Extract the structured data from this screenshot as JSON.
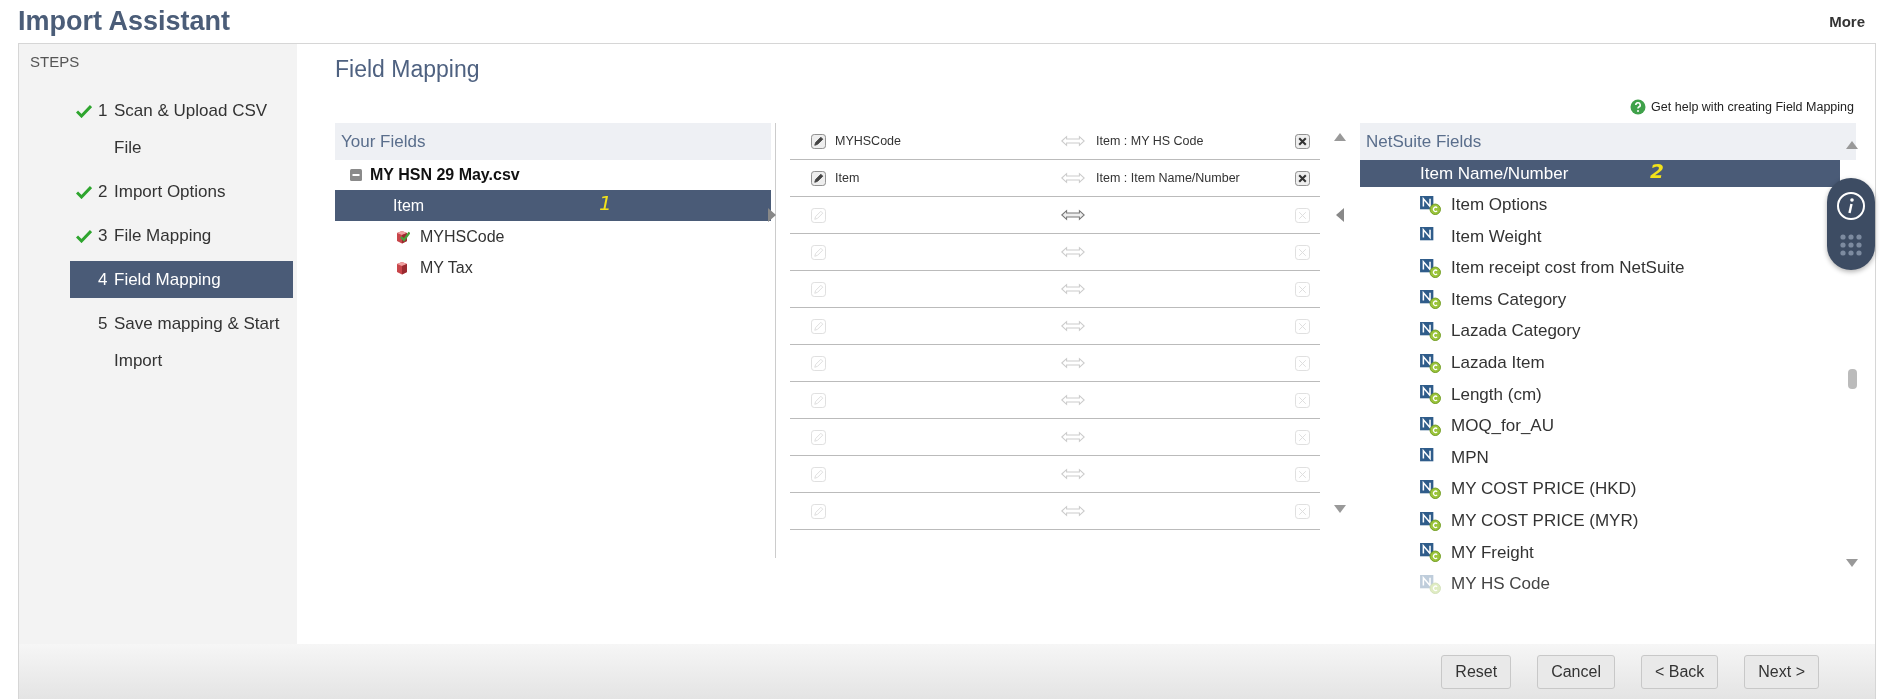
{
  "header": {
    "title": "Import Assistant",
    "more_link": "More"
  },
  "steps": {
    "heading": "STEPS",
    "items": [
      {
        "number": "1",
        "label": "Scan & Upload CSV File",
        "completed": true,
        "selected": false
      },
      {
        "number": "2",
        "label": "Import Options",
        "completed": true,
        "selected": false
      },
      {
        "number": "3",
        "label": "File Mapping",
        "completed": true,
        "selected": false
      },
      {
        "number": "4",
        "label": "Field Mapping",
        "completed": false,
        "selected": true
      },
      {
        "number": "5",
        "label": "Save mapping & Start Import",
        "completed": false,
        "selected": false
      }
    ]
  },
  "page_title": "Field Mapping",
  "help_link": "Get help with creating Field Mapping",
  "your_fields": {
    "heading": "Your Fields",
    "file": {
      "name": "MY HSN 29 May.csv",
      "expanded": true,
      "children": [
        {
          "label": "Item",
          "selected": true,
          "annotation": "1",
          "children": [
            {
              "label": "MYHSCode",
              "kind": "mapped",
              "selected": false
            },
            {
              "label": "MY Tax",
              "kind": "unmapped",
              "selected": false
            }
          ]
        }
      ]
    }
  },
  "mappings": [
    {
      "source": "MYHSCode",
      "target": "Item : MY HS Code",
      "enabled": true,
      "selected": false
    },
    {
      "source": "Item",
      "target": "Item : Item Name/Number",
      "enabled": true,
      "selected": false
    },
    {
      "enabled": false,
      "selected": true
    },
    {
      "enabled": false,
      "selected": false
    },
    {
      "enabled": false,
      "selected": false
    },
    {
      "enabled": false,
      "selected": false
    },
    {
      "enabled": false,
      "selected": false
    },
    {
      "enabled": false,
      "selected": false
    },
    {
      "enabled": false,
      "selected": false
    },
    {
      "enabled": false,
      "selected": false
    },
    {
      "enabled": false,
      "selected": false
    }
  ],
  "netsuite_fields": {
    "heading": "NetSuite Fields",
    "items": [
      {
        "label": "Item Name/Number",
        "kind": "none",
        "selected": true,
        "disabled": false,
        "annotation": "2"
      },
      {
        "label": "Item Options",
        "kind": "custom",
        "selected": false,
        "disabled": false
      },
      {
        "label": "Item Weight",
        "kind": "standard",
        "selected": false,
        "disabled": false
      },
      {
        "label": "Item receipt cost from NetSuite",
        "kind": "custom",
        "selected": false,
        "disabled": false
      },
      {
        "label": "Items Category",
        "kind": "custom",
        "selected": false,
        "disabled": false
      },
      {
        "label": "Lazada Category",
        "kind": "custom",
        "selected": false,
        "disabled": false
      },
      {
        "label": "Lazada Item",
        "kind": "custom",
        "selected": false,
        "disabled": false
      },
      {
        "label": "Length (cm)",
        "kind": "custom",
        "selected": false,
        "disabled": false
      },
      {
        "label": "MOQ_for_AU",
        "kind": "custom",
        "selected": false,
        "disabled": false
      },
      {
        "label": "MPN",
        "kind": "standard",
        "selected": false,
        "disabled": false
      },
      {
        "label": "MY COST PRICE (HKD)",
        "kind": "custom",
        "selected": false,
        "disabled": false
      },
      {
        "label": "MY COST PRICE (MYR)",
        "kind": "custom",
        "selected": false,
        "disabled": false
      },
      {
        "label": "MY Freight",
        "kind": "custom",
        "selected": false,
        "disabled": false
      },
      {
        "label": "MY HS Code",
        "kind": "custom",
        "selected": false,
        "disabled": true
      }
    ]
  },
  "buttons": [
    "Reset",
    "Cancel",
    "< Back",
    "Next >"
  ]
}
